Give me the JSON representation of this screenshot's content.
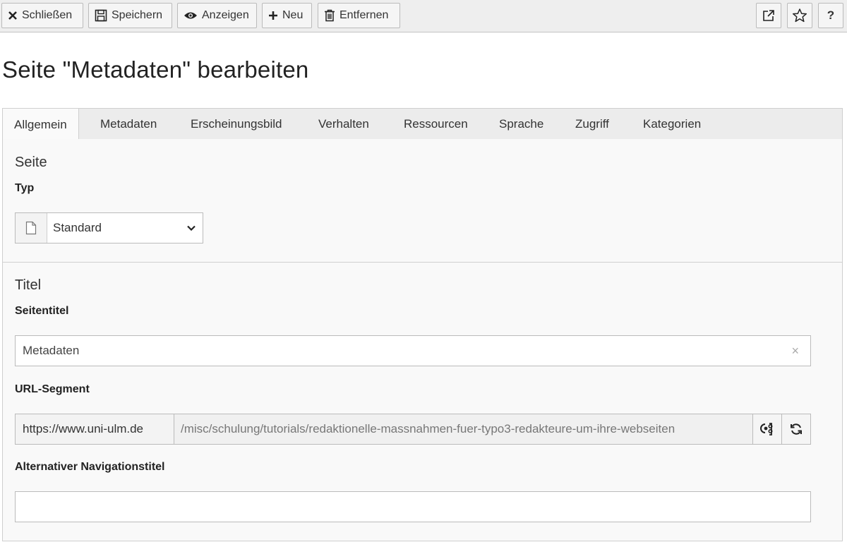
{
  "toolbar": {
    "close_label": "Schließen",
    "save_label": "Speichern",
    "view_label": "Anzeigen",
    "new_label": "Neu",
    "delete_label": "Entfernen",
    "help_label": "?",
    "icons": [
      "close-icon",
      "save-icon",
      "eye-icon",
      "plus-icon",
      "trash-icon",
      "external-link-icon",
      "star-icon"
    ]
  },
  "page": {
    "title": "Seite \"Metadaten\" bearbeiten"
  },
  "tabs": [
    {
      "label": "Allgemein",
      "active": true
    },
    {
      "label": "Metadaten"
    },
    {
      "label": "Erscheinungsbild"
    },
    {
      "label": "Verhalten"
    },
    {
      "label": "Ressourcen"
    },
    {
      "label": "Sprache"
    },
    {
      "label": "Zugriff"
    },
    {
      "label": "Kategorien"
    }
  ],
  "sections": {
    "page": {
      "title": "Seite",
      "type_label": "Typ",
      "type_value": "Standard"
    },
    "title": {
      "title": "Titel",
      "page_title_label": "Seitentitel",
      "page_title_value": "Metadaten",
      "clear_symbol": "×",
      "url_segment_label": "URL-Segment",
      "url_prefix": "https://www.uni-ulm.de",
      "url_path": "/misc/schulung/tutorials/redaktionelle-massnahmen-fuer-typo3-redakteure-um-ihre-webseiten",
      "nav_title_label": "Alternativer Navigationstitel",
      "nav_title_value": ""
    }
  },
  "colors": {
    "toolbar_bg": "#eeeeee",
    "panel_bg": "#f9f9f9",
    "border": "#bbbbbb"
  }
}
